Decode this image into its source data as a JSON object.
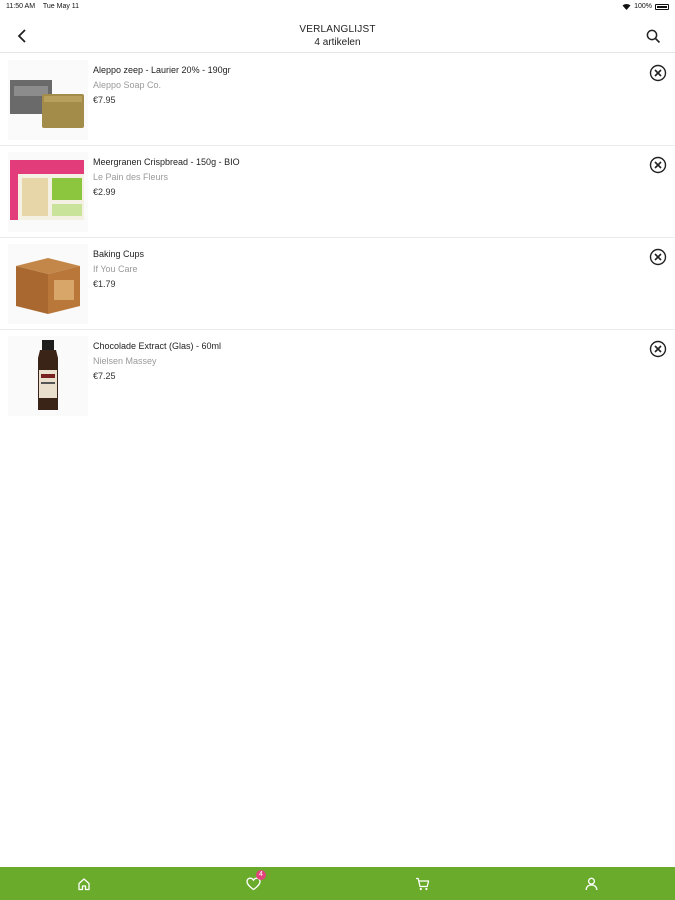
{
  "status": {
    "time": "11:50 AM",
    "date": "Tue May 11",
    "battery": "100%"
  },
  "header": {
    "title": "VERLANGLIJST",
    "subtitle": "4 artikelen",
    "back_icon": "chevron-left-icon",
    "search_icon": "search-icon"
  },
  "items": [
    {
      "name": "Aleppo zeep - Laurier 20% - 190gr",
      "brand": "Aleppo Soap Co.",
      "price": "€7.95"
    },
    {
      "name": "Meergranen Crispbread - 150g - BIO",
      "brand": "Le Pain des Fleurs",
      "price": "€2.99"
    },
    {
      "name": "Baking Cups",
      "brand": "If You Care",
      "price": "€1.79"
    },
    {
      "name": "Chocolade Extract  (Glas) - 60ml",
      "brand": "Nielsen Massey",
      "price": "€7.25"
    }
  ],
  "tabbar": {
    "wishlist_badge": "4",
    "accent": "#6aab2c",
    "badge_color": "#e0457b"
  }
}
